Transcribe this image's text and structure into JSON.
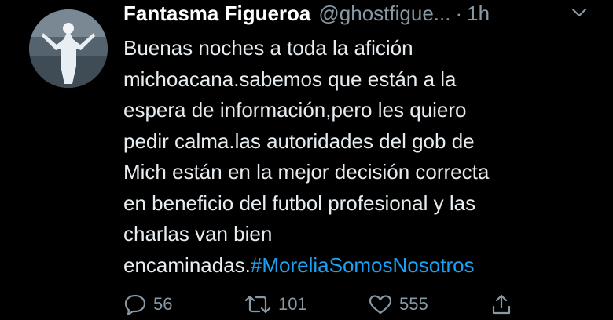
{
  "tweet": {
    "author_name": "Fantasma Figueroa",
    "author_handle": "@ghostfigue...",
    "separator": "·",
    "time": "1h",
    "text_lines": [
      "Buenas noches a toda la afición",
      "michoacana.sabemos que están a la",
      "espera de información,pero les quiero",
      "pedir calma.las autoridades del gob de",
      "Mich están en la mejor decisión correcta",
      "en beneficio del futbol profesional y las",
      "charlas van bien"
    ],
    "last_line_text": "encaminadas.",
    "hashtag": "#MoreliaSomosNosotros"
  },
  "actions": {
    "reply_count": "56",
    "retweet_count": "101",
    "like_count": "555"
  },
  "icons": {
    "avatar": "profile-photo",
    "menu": "chevron-down-icon",
    "reply": "reply-icon",
    "retweet": "retweet-icon",
    "like": "heart-icon",
    "share": "share-icon"
  },
  "colors": {
    "background": "#000000",
    "text": "#e6ecf0",
    "secondary": "#8899a6",
    "link": "#1da1f2"
  }
}
